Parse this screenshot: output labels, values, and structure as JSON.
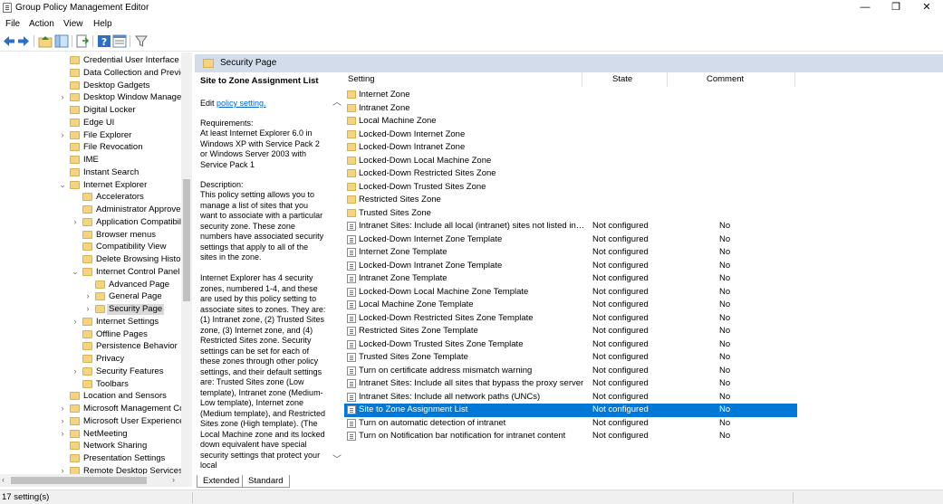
{
  "window": {
    "title": "Group Policy Management Editor",
    "controls": {
      "minimize": "—",
      "maximize": "❐",
      "close": "✕"
    }
  },
  "menu": [
    "File",
    "Action",
    "View",
    "Help"
  ],
  "toolbar_icons": [
    "back-arrow-icon",
    "forward-arrow-icon",
    "up-folder-icon",
    "show-hide-tree-icon",
    "export-list-icon",
    "help-icon",
    "properties-icon",
    "filter-icon"
  ],
  "tree": {
    "items": [
      {
        "label": "Credential User Interface",
        "depth": 0,
        "expander": ""
      },
      {
        "label": "Data Collection and Previe",
        "depth": 0,
        "expander": ""
      },
      {
        "label": "Desktop Gadgets",
        "depth": 0,
        "expander": ""
      },
      {
        "label": "Desktop Window Manager",
        "depth": 0,
        "expander": ">"
      },
      {
        "label": "Digital Locker",
        "depth": 0,
        "expander": ""
      },
      {
        "label": "Edge UI",
        "depth": 0,
        "expander": ""
      },
      {
        "label": "File Explorer",
        "depth": 0,
        "expander": ">"
      },
      {
        "label": "File Revocation",
        "depth": 0,
        "expander": ""
      },
      {
        "label": "IME",
        "depth": 0,
        "expander": ""
      },
      {
        "label": "Instant Search",
        "depth": 0,
        "expander": ""
      },
      {
        "label": "Internet Explorer",
        "depth": 0,
        "expander": "v"
      },
      {
        "label": "Accelerators",
        "depth": 1,
        "expander": ""
      },
      {
        "label": "Administrator Approve",
        "depth": 1,
        "expander": ""
      },
      {
        "label": "Application Compatibil",
        "depth": 1,
        "expander": ">"
      },
      {
        "label": "Browser menus",
        "depth": 1,
        "expander": ""
      },
      {
        "label": "Compatibility View",
        "depth": 1,
        "expander": ""
      },
      {
        "label": "Delete Browsing Histor",
        "depth": 1,
        "expander": ""
      },
      {
        "label": "Internet Control Panel",
        "depth": 1,
        "expander": "v"
      },
      {
        "label": "Advanced Page",
        "depth": 2,
        "expander": ""
      },
      {
        "label": "General Page",
        "depth": 2,
        "expander": ">"
      },
      {
        "label": "Security Page",
        "depth": 2,
        "expander": ">",
        "selected": true
      },
      {
        "label": "Internet Settings",
        "depth": 1,
        "expander": ">"
      },
      {
        "label": "Offline Pages",
        "depth": 1,
        "expander": ""
      },
      {
        "label": "Persistence Behavior",
        "depth": 1,
        "expander": ""
      },
      {
        "label": "Privacy",
        "depth": 1,
        "expander": ""
      },
      {
        "label": "Security Features",
        "depth": 1,
        "expander": ">"
      },
      {
        "label": "Toolbars",
        "depth": 1,
        "expander": ""
      },
      {
        "label": "Location and Sensors",
        "depth": 0,
        "expander": ""
      },
      {
        "label": "Microsoft Management Co",
        "depth": 0,
        "expander": ">"
      },
      {
        "label": "Microsoft User Experience",
        "depth": 0,
        "expander": ">"
      },
      {
        "label": "NetMeeting",
        "depth": 0,
        "expander": ">"
      },
      {
        "label": "Network Sharing",
        "depth": 0,
        "expander": ""
      },
      {
        "label": "Presentation Settings",
        "depth": 0,
        "expander": ""
      },
      {
        "label": "Remote Desktop Services",
        "depth": 0,
        "expander": ">"
      }
    ]
  },
  "header": {
    "label": "Security Page"
  },
  "description": {
    "title": "Site to Zone Assignment List",
    "edit_prefix": "Edit",
    "edit_link": "policy setting.",
    "requirements_label": "Requirements:",
    "requirements_text": "At least Internet Explorer 6.0 in Windows XP with Service Pack 2 or Windows Server 2003 with Service Pack 1",
    "description_label": "Description:",
    "description_text": "This policy setting allows you to manage a list of sites that you want to associate with a particular security zone. These zone numbers have associated security settings that apply to all of the sites in the zone.",
    "description_text2": "Internet Explorer has 4 security zones, numbered 1-4, and these are used by this policy setting to associate sites to zones. They are: (1) Intranet zone, (2) Trusted Sites zone, (3) Internet zone, and (4) Restricted Sites zone. Security settings can be set for each of these zones through other policy settings, and their default settings are: Trusted Sites zone (Low template), Intranet zone (Medium-Low template), Internet zone (Medium template), and Restricted Sites zone (High template). (The Local Machine zone and its locked down equivalent have special security settings that protect your local"
  },
  "list": {
    "columns": {
      "setting": "Setting",
      "state": "State",
      "comment": "Comment"
    },
    "rows": [
      {
        "type": "folder",
        "name": "Internet Zone",
        "state": "",
        "comment": ""
      },
      {
        "type": "folder",
        "name": "Intranet Zone",
        "state": "",
        "comment": ""
      },
      {
        "type": "folder",
        "name": "Local Machine Zone",
        "state": "",
        "comment": ""
      },
      {
        "type": "folder",
        "name": "Locked-Down Internet Zone",
        "state": "",
        "comment": ""
      },
      {
        "type": "folder",
        "name": "Locked-Down Intranet Zone",
        "state": "",
        "comment": ""
      },
      {
        "type": "folder",
        "name": "Locked-Down Local Machine Zone",
        "state": "",
        "comment": ""
      },
      {
        "type": "folder",
        "name": "Locked-Down Restricted Sites Zone",
        "state": "",
        "comment": ""
      },
      {
        "type": "folder",
        "name": "Locked-Down Trusted Sites Zone",
        "state": "",
        "comment": ""
      },
      {
        "type": "folder",
        "name": "Restricted Sites Zone",
        "state": "",
        "comment": ""
      },
      {
        "type": "folder",
        "name": "Trusted Sites Zone",
        "state": "",
        "comment": ""
      },
      {
        "type": "policy",
        "name": "Intranet Sites: Include all local (intranet) sites not listed in ot...",
        "state": "Not configured",
        "comment": "No"
      },
      {
        "type": "policy",
        "name": "Locked-Down Internet Zone Template",
        "state": "Not configured",
        "comment": "No"
      },
      {
        "type": "policy",
        "name": "Internet Zone Template",
        "state": "Not configured",
        "comment": "No"
      },
      {
        "type": "policy",
        "name": "Locked-Down Intranet Zone Template",
        "state": "Not configured",
        "comment": "No"
      },
      {
        "type": "policy",
        "name": "Intranet Zone Template",
        "state": "Not configured",
        "comment": "No"
      },
      {
        "type": "policy",
        "name": "Locked-Down Local Machine Zone Template",
        "state": "Not configured",
        "comment": "No"
      },
      {
        "type": "policy",
        "name": "Local Machine Zone Template",
        "state": "Not configured",
        "comment": "No"
      },
      {
        "type": "policy",
        "name": "Locked-Down Restricted Sites Zone Template",
        "state": "Not configured",
        "comment": "No"
      },
      {
        "type": "policy",
        "name": "Restricted Sites Zone Template",
        "state": "Not configured",
        "comment": "No"
      },
      {
        "type": "policy",
        "name": "Locked-Down Trusted Sites Zone Template",
        "state": "Not configured",
        "comment": "No"
      },
      {
        "type": "policy",
        "name": "Trusted Sites Zone Template",
        "state": "Not configured",
        "comment": "No"
      },
      {
        "type": "policy",
        "name": "Turn on certificate address mismatch warning",
        "state": "Not configured",
        "comment": "No"
      },
      {
        "type": "policy",
        "name": "Intranet Sites: Include all sites that bypass the proxy server",
        "state": "Not configured",
        "comment": "No"
      },
      {
        "type": "policy",
        "name": "Intranet Sites: Include all network paths (UNCs)",
        "state": "Not configured",
        "comment": "No"
      },
      {
        "type": "policy",
        "name": "Site to Zone Assignment List",
        "state": "Not configured",
        "comment": "No",
        "selected": true
      },
      {
        "type": "policy",
        "name": "Turn on automatic detection of intranet",
        "state": "Not configured",
        "comment": "No"
      },
      {
        "type": "policy",
        "name": "Turn on Notification bar notification for intranet content",
        "state": "Not configured",
        "comment": "No"
      }
    ]
  },
  "tabs": [
    "Extended",
    "Standard"
  ],
  "status": {
    "text": "17 setting(s)"
  },
  "colors": {
    "selection": "#0078d7",
    "header_band": "#d3dcea",
    "folder": "#f4d47e"
  }
}
